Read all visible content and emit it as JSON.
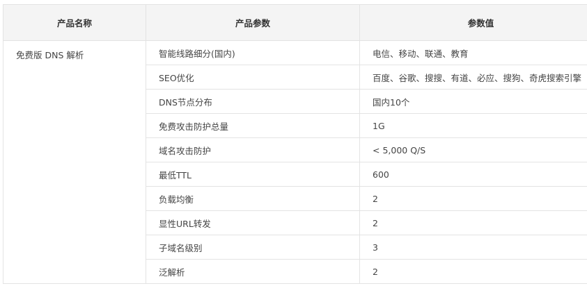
{
  "table": {
    "headers": [
      "产品名称",
      "产品参数",
      "参数值"
    ],
    "product_name": "免费版 DNS 解析",
    "rows": [
      {
        "param": "智能线路细分(国内)",
        "value": "电信、移动、联通、教育"
      },
      {
        "param": "SEO优化",
        "value": "百度、谷歌、搜搜、有道、必应、搜狗、奇虎搜索引擎"
      },
      {
        "param": "DNS节点分布",
        "value": "国内10个"
      },
      {
        "param": "免费攻击防护总量",
        "value": "1G"
      },
      {
        "param": "域名攻击防护",
        "value": "< 5,000 Q/S"
      },
      {
        "param": "最低TTL",
        "value": "600"
      },
      {
        "param": "负载均衡",
        "value": "2"
      },
      {
        "param": "显性URL转发",
        "value": "2"
      },
      {
        "param": "子域名级别",
        "value": "3"
      },
      {
        "param": "泛解析",
        "value": "2"
      }
    ]
  }
}
